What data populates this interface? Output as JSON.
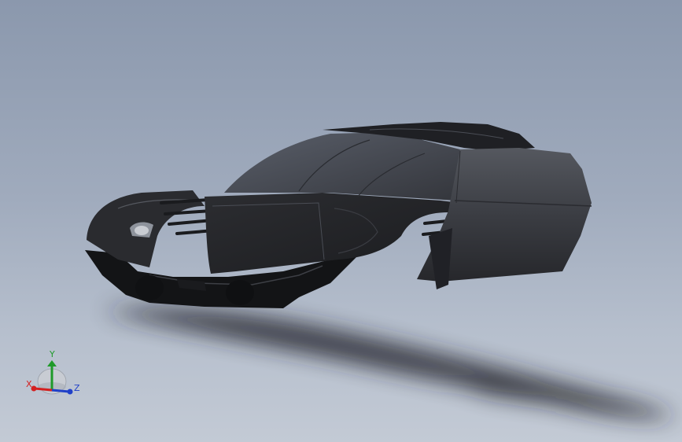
{
  "viewport": {
    "background_top": "#8b98ad",
    "background_bottom": "#c3cad5"
  },
  "model": {
    "body_color": "#2a2b2f",
    "glass_color": "#4a4d55",
    "shadow_color": "#1c1d22"
  },
  "triad": {
    "x_label": "X",
    "y_label": "Y",
    "z_label": "Z",
    "x_color": "#d42020",
    "y_color": "#1f9a2a",
    "z_color": "#2040c8"
  }
}
